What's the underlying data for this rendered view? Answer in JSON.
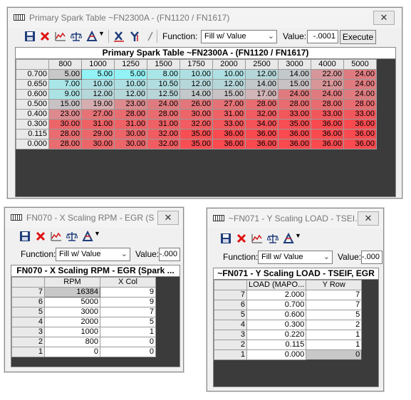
{
  "win1": {
    "title": "Primary Spark Table ~FN2300A - (FN1120 / FN1617)",
    "function_label": "Function:",
    "function_value": "Fill w/ Value",
    "value_label": "Value:",
    "value_input": "-.0001",
    "execute_label": "Execute",
    "grid_title": "Primary Spark Table ~FN2300A - (FN1120 / FN1617)",
    "col_headers": [
      "800",
      "1000",
      "1250",
      "1500",
      "1750",
      "2000",
      "2500",
      "3000",
      "4000",
      "5000"
    ],
    "rows": [
      {
        "label": "0.700",
        "cells": [
          "5.00",
          "5.00",
          "5.00",
          "8.00",
          "10.00",
          "10.00",
          "12.00",
          "14.00",
          "22.00",
          "24.00"
        ]
      },
      {
        "label": "0.650",
        "cells": [
          "7.00",
          "10.00",
          "10.00",
          "10.50",
          "12.00",
          "12.00",
          "14.00",
          "15.00",
          "21.00",
          "24.00"
        ]
      },
      {
        "label": "0.600",
        "cells": [
          "9.00",
          "12.00",
          "12.00",
          "12.50",
          "14.00",
          "15.00",
          "17.00",
          "24.00",
          "24.00",
          "24.00"
        ]
      },
      {
        "label": "0.500",
        "cells": [
          "15.00",
          "19.00",
          "23.00",
          "24.00",
          "26.00",
          "27.00",
          "28.00",
          "28.00",
          "28.00",
          "28.00"
        ]
      },
      {
        "label": "0.400",
        "cells": [
          "23.00",
          "27.00",
          "28.00",
          "28.00",
          "30.00",
          "31.00",
          "32.00",
          "33.00",
          "33.00",
          "33.00"
        ]
      },
      {
        "label": "0.300",
        "cells": [
          "30.00",
          "31.00",
          "31.00",
          "31.00",
          "32.00",
          "33.00",
          "34.00",
          "35.00",
          "36.00",
          "36.00"
        ]
      },
      {
        "label": "0.115",
        "cells": [
          "28.00",
          "29.00",
          "30.00",
          "32.00",
          "35.00",
          "36.00",
          "36.00",
          "36.00",
          "36.00",
          "36.00"
        ]
      },
      {
        "label": "0.000",
        "cells": [
          "28.00",
          "30.00",
          "30.00",
          "32.00",
          "35.00",
          "36.00",
          "36.00",
          "36.00",
          "36.00",
          "36.00"
        ]
      }
    ],
    "cell_colors": [
      [
        "#a6dde3",
        "#92f2f5",
        "#92f2f5",
        "#a9e6e8",
        "#aee0e3",
        "#aee0e3",
        "#b6d7da",
        "#c3c8cb",
        "#d7979a",
        "#df7b7f"
      ],
      [
        "#a9e6e8",
        "#aee0e3",
        "#aee0e3",
        "#b1dde0",
        "#b6d7da",
        "#b6d7da",
        "#c3c8cb",
        "#c9c2c5",
        "#d99699",
        "#df7b7f"
      ],
      [
        "#abe3e5",
        "#b6d7da",
        "#b6d7da",
        "#b8d5d8",
        "#c3c8cb",
        "#c9c2c5",
        "#d2b5b8",
        "#df7b7f",
        "#df7b7f",
        "#df7b7f"
      ],
      [
        "#c9c2c5",
        "#d6aeb1",
        "#dd8a8e",
        "#df7b7f",
        "#e3767a",
        "#e57276",
        "#e86c70",
        "#e86c70",
        "#e86c70",
        "#e86c70"
      ],
      [
        "#dd8a8e",
        "#e57276",
        "#e86c70",
        "#e86c70",
        "#ec6569",
        "#ee6165",
        "#f05c61",
        "#f2575c",
        "#f2575c",
        "#f2575c"
      ],
      [
        "#ec6569",
        "#ee6165",
        "#ee6165",
        "#ee6165",
        "#f05c61",
        "#f2575c",
        "#f45358",
        "#f64e53",
        "#f84a4f",
        "#f84a4f"
      ],
      [
        "#e86c70",
        "#ea686c",
        "#ec6569",
        "#f05c61",
        "#f64e53",
        "#f84a4f",
        "#f84a4f",
        "#f84a4f",
        "#f84a4f",
        "#f84a4f"
      ],
      [
        "#e86c70",
        "#ec6569",
        "#ec6569",
        "#f05c61",
        "#f64e53",
        "#f84a4f",
        "#f84a4f",
        "#f84a4f",
        "#f84a4f",
        "#f84a4f"
      ]
    ]
  },
  "win2": {
    "title": "FN070 - X Scaling RPM - EGR (S...",
    "function_label": "Function:",
    "function_value": "Fill w/ Value",
    "value_label": "Value:",
    "value_input": "-.000",
    "grid_title": "FN070 - X Scaling RPM - EGR (Spark ...",
    "col_headers": [
      "RPM",
      "X  Col"
    ],
    "rows": [
      {
        "label": "7",
        "cells": [
          "16384",
          "9"
        ]
      },
      {
        "label": "6",
        "cells": [
          "5000",
          "9"
        ]
      },
      {
        "label": "5",
        "cells": [
          "3000",
          "7"
        ]
      },
      {
        "label": "4",
        "cells": [
          "2000",
          "5"
        ]
      },
      {
        "label": "3",
        "cells": [
          "1000",
          "1"
        ]
      },
      {
        "label": "2",
        "cells": [
          "800",
          "0"
        ]
      },
      {
        "label": "1",
        "cells": [
          "0",
          "0"
        ]
      }
    ]
  },
  "win3": {
    "title": "~FN071 - Y Scaling LOAD - TSEI...",
    "function_label": "Function:",
    "function_value": "Fill w/ Value",
    "value_label": "Value:",
    "value_input": "-.000",
    "grid_title": "~FN071 - Y Scaling LOAD - TSEIF, EGR",
    "col_headers": [
      "LOAD (MAPO...",
      "Y  Row"
    ],
    "rows": [
      {
        "label": "7",
        "cells": [
          "2.000",
          "7"
        ]
      },
      {
        "label": "6",
        "cells": [
          "0.700",
          "7"
        ]
      },
      {
        "label": "5",
        "cells": [
          "0.600",
          "5"
        ]
      },
      {
        "label": "4",
        "cells": [
          "0.300",
          "2"
        ]
      },
      {
        "label": "3",
        "cells": [
          "0.220",
          "1"
        ]
      },
      {
        "label": "2",
        "cells": [
          "0.115",
          "1"
        ]
      },
      {
        "label": "1",
        "cells": [
          "0.000",
          "0"
        ]
      }
    ]
  },
  "icons": {
    "close": "✕",
    "chevron": "⌄"
  }
}
